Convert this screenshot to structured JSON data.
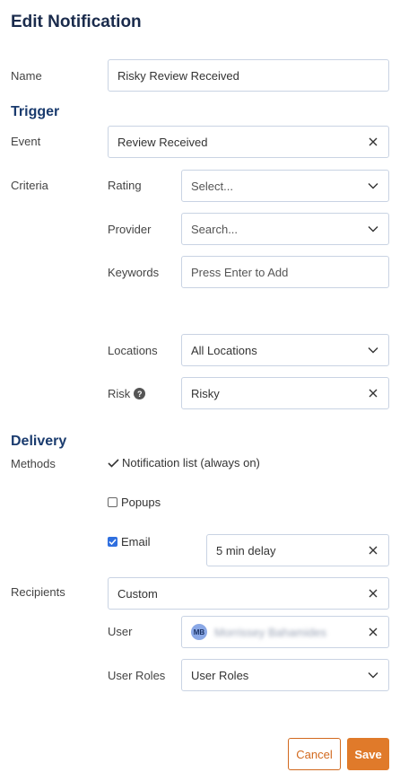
{
  "header": {
    "title": "Edit Notification"
  },
  "name": {
    "label": "Name",
    "value": "Risky Review Received"
  },
  "trigger": {
    "heading": "Trigger",
    "event": {
      "label": "Event",
      "value": "Review Received"
    },
    "criteria_label": "Criteria",
    "rating": {
      "label": "Rating",
      "placeholder": "Select..."
    },
    "provider": {
      "label": "Provider",
      "placeholder": "Search..."
    },
    "keywords": {
      "label": "Keywords",
      "placeholder": "Press Enter to Add"
    },
    "locations": {
      "label": "Locations",
      "value": "All Locations"
    },
    "risk": {
      "label": "Risk",
      "help": "?",
      "value": "Risky"
    }
  },
  "delivery": {
    "heading": "Delivery",
    "methods_label": "Methods",
    "notification_list": "Notification list (always on)",
    "popups": {
      "label": "Popups",
      "checked": false
    },
    "email": {
      "label": "Email",
      "checked": true,
      "delay": "5 min delay"
    },
    "recipients": {
      "label": "Recipients",
      "value": "Custom"
    },
    "user": {
      "label": "User",
      "initials": "MB",
      "name": "Morrissey Bahamides"
    },
    "user_roles": {
      "label": "User Roles",
      "value": "User Roles"
    }
  },
  "footer": {
    "cancel_label": "Cancel",
    "save_label": "Save"
  },
  "colors": {
    "accent": "#e07a2a",
    "heading": "#1a3b6e",
    "checkbox": "#2f6fdf"
  },
  "icons": {
    "clear": "close-icon",
    "dropdown": "chevron-down-icon",
    "check": "checkmark-icon",
    "help": "help-icon"
  }
}
